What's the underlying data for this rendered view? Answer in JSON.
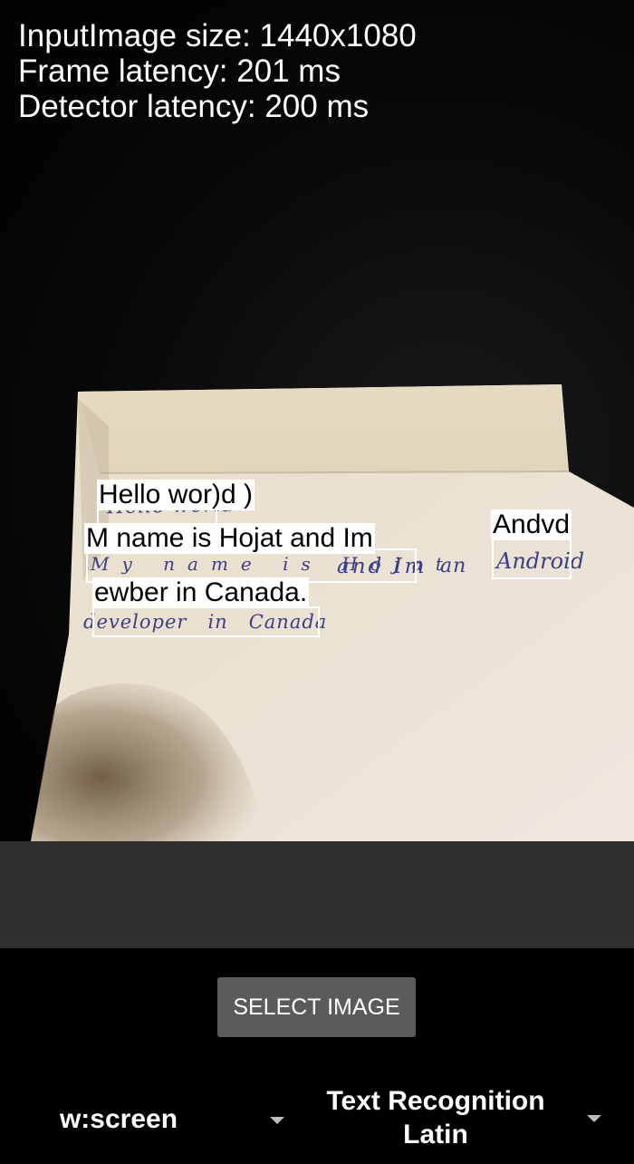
{
  "stats": {
    "input_image_size": "InputImage size: 1440x1080",
    "frame_latency": "Frame latency: 201 ms",
    "detector_latency": "Detector latency: 200 ms"
  },
  "handwriting": {
    "line1": "Hello world",
    "line2_words": [
      "My",
      "name",
      "is",
      "Hojat",
      "and",
      "Im"
    ],
    "line2_extra": "an",
    "line2_android": "Android",
    "line3": "developer   in   Canada"
  },
  "detections": [
    {
      "id": "hello",
      "text": "Hello wor)d )"
    },
    {
      "id": "name",
      "text": "M name is Hojat and Im"
    },
    {
      "id": "canada",
      "text": "ewber in Canada."
    },
    {
      "id": "android",
      "text": "Andvd"
    }
  ],
  "select_image_button": {
    "label": "SELECT IMAGE"
  },
  "preview_selector": {
    "value": "w:screen"
  },
  "feature_selector": {
    "value_line1": "Text Recognition",
    "value_line2": "Latin"
  },
  "colors": {
    "overlay_box": "#ffffff",
    "button_bg": "#5b5b5b",
    "gray_band": "#2f2f2f",
    "ink": "#3d3f86"
  }
}
